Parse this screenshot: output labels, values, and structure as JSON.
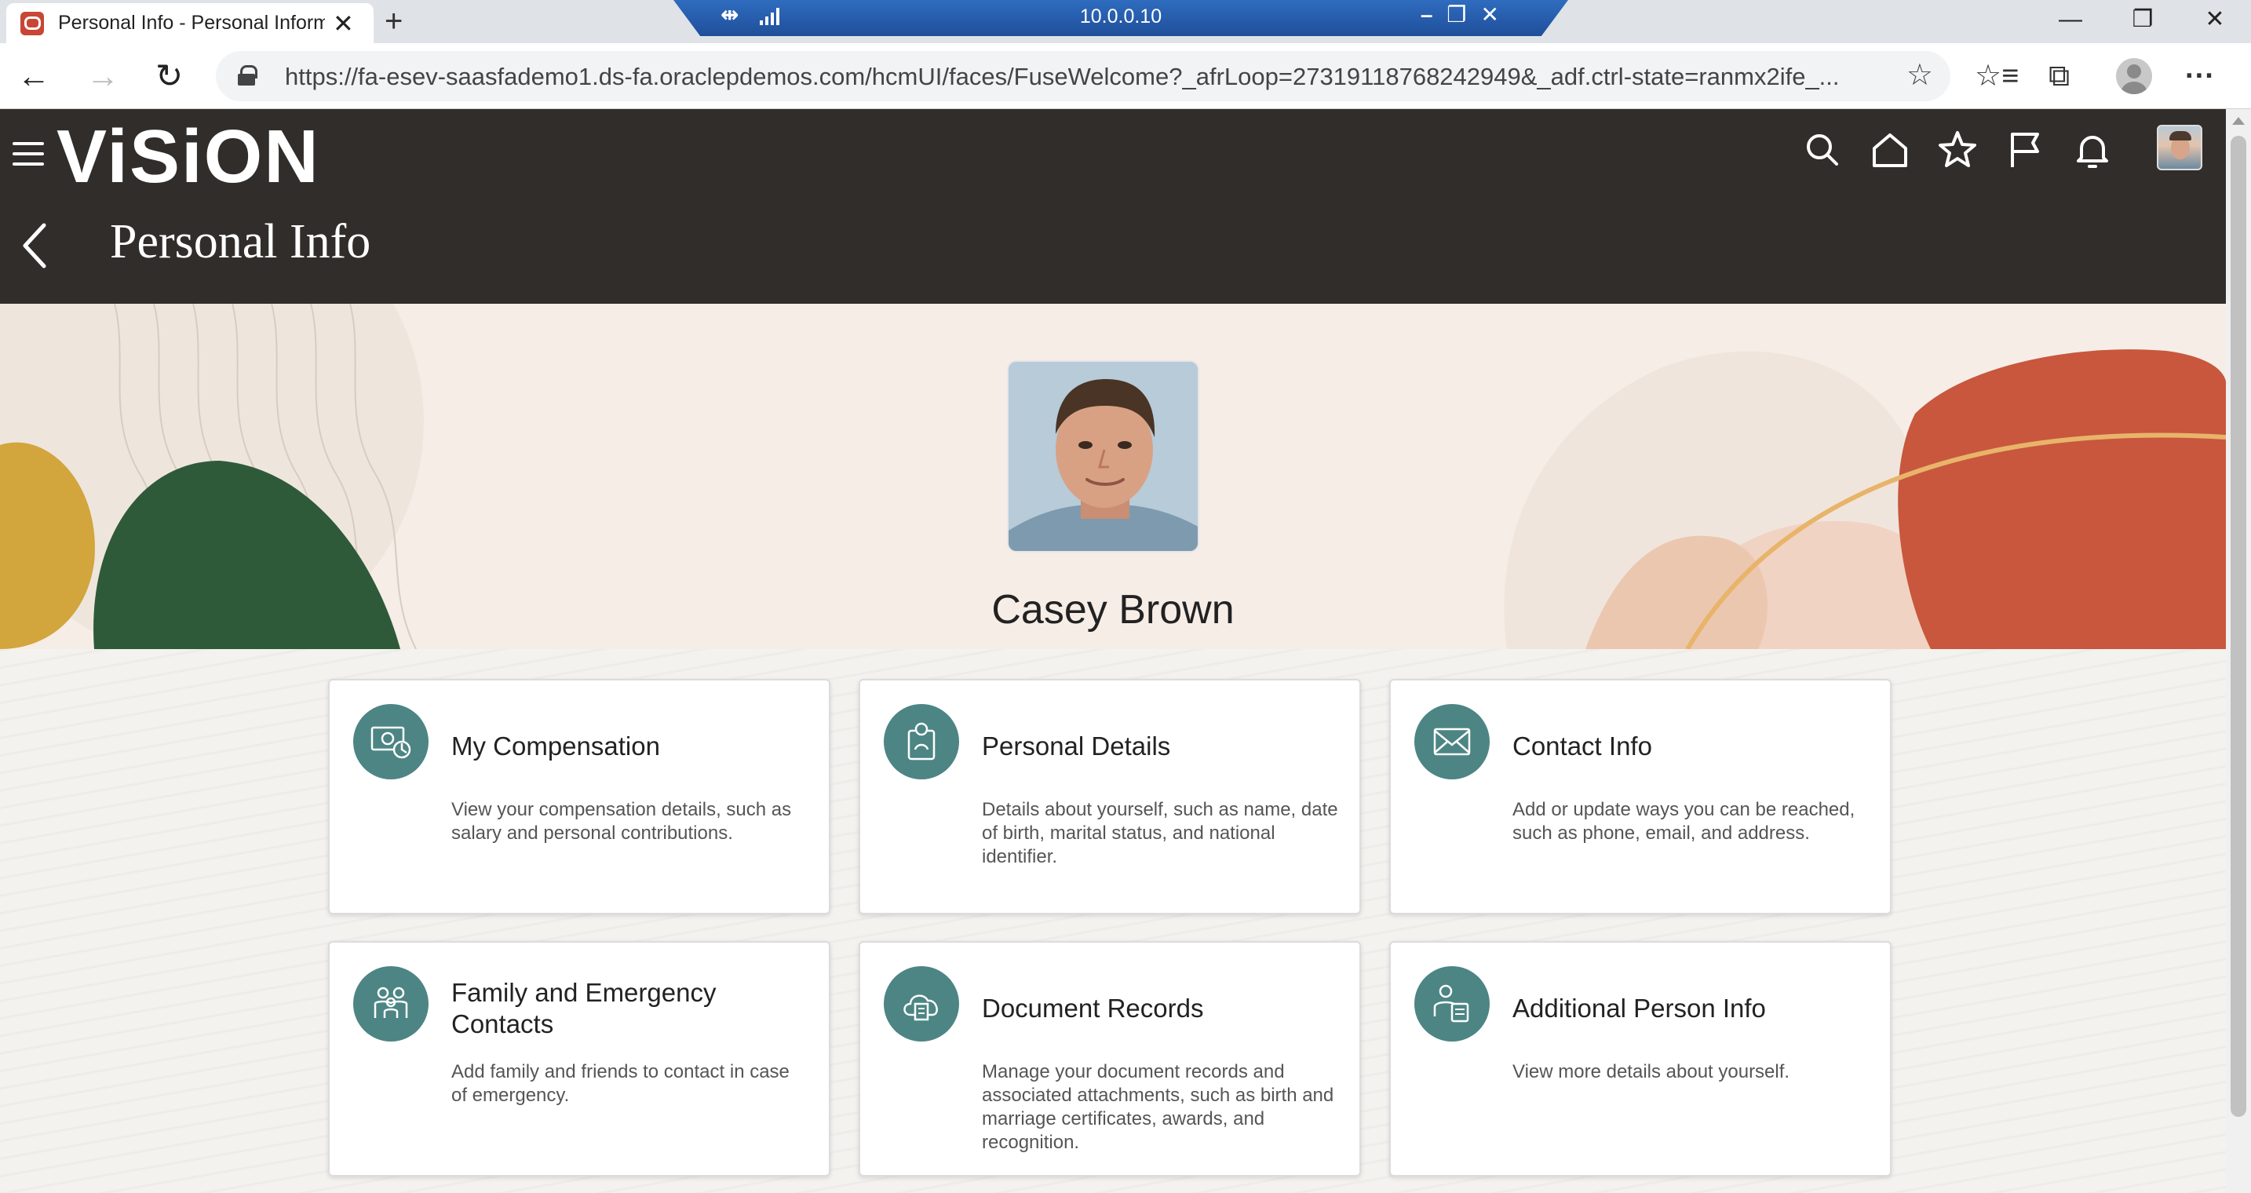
{
  "browser": {
    "tab_title": "Personal Info - Personal Informat",
    "tab_close": "✕",
    "new_tab": "+",
    "remote_session_ip": "10.0.0.10",
    "url": "https://fa-esev-saasfademo1.ds-fa.oraclepdemos.com/hcmUI/faces/FuseWelcome?_afrLoop=27319118768242949&_adf.ctrl-state=ranmx2ife_...",
    "win_minimize": "—",
    "win_restore": "❐",
    "win_close": "✕",
    "back": "←",
    "forward": "→",
    "refresh": "↻",
    "favorite_star": "☆",
    "favorites_list": "☆≡",
    "collections": "⧉",
    "more": "···"
  },
  "app": {
    "brand": "ViSiON",
    "page_title": "Personal Info"
  },
  "profile": {
    "name": "Casey Brown"
  },
  "cards": [
    {
      "title": "My Compensation",
      "description": "View your compensation details, such as salary and personal contributions.",
      "icon": "compensation-icon"
    },
    {
      "title": "Personal Details",
      "description": "Details about yourself, such as name, date of birth, marital status, and national identifier.",
      "icon": "person-icon"
    },
    {
      "title": "Contact Info",
      "description": "Add or update ways you can be reached, such as phone, email, and address.",
      "icon": "envelope-icon"
    },
    {
      "title": "Family and Emergency Contacts",
      "description": "Add family and friends to contact in case of emergency.",
      "icon": "family-icon"
    },
    {
      "title": "Document Records",
      "description": "Manage your document records and associated attachments, such as birth and marriage certificates, awards, and recognition.",
      "icon": "document-cloud-icon"
    },
    {
      "title": "Additional Person Info",
      "description": "View more details about yourself.",
      "icon": "person-info-icon"
    }
  ],
  "colors": {
    "header_bg": "#312d2a",
    "card_icon_bg": "#4c8584",
    "hero_bg": "#f6ede7"
  }
}
